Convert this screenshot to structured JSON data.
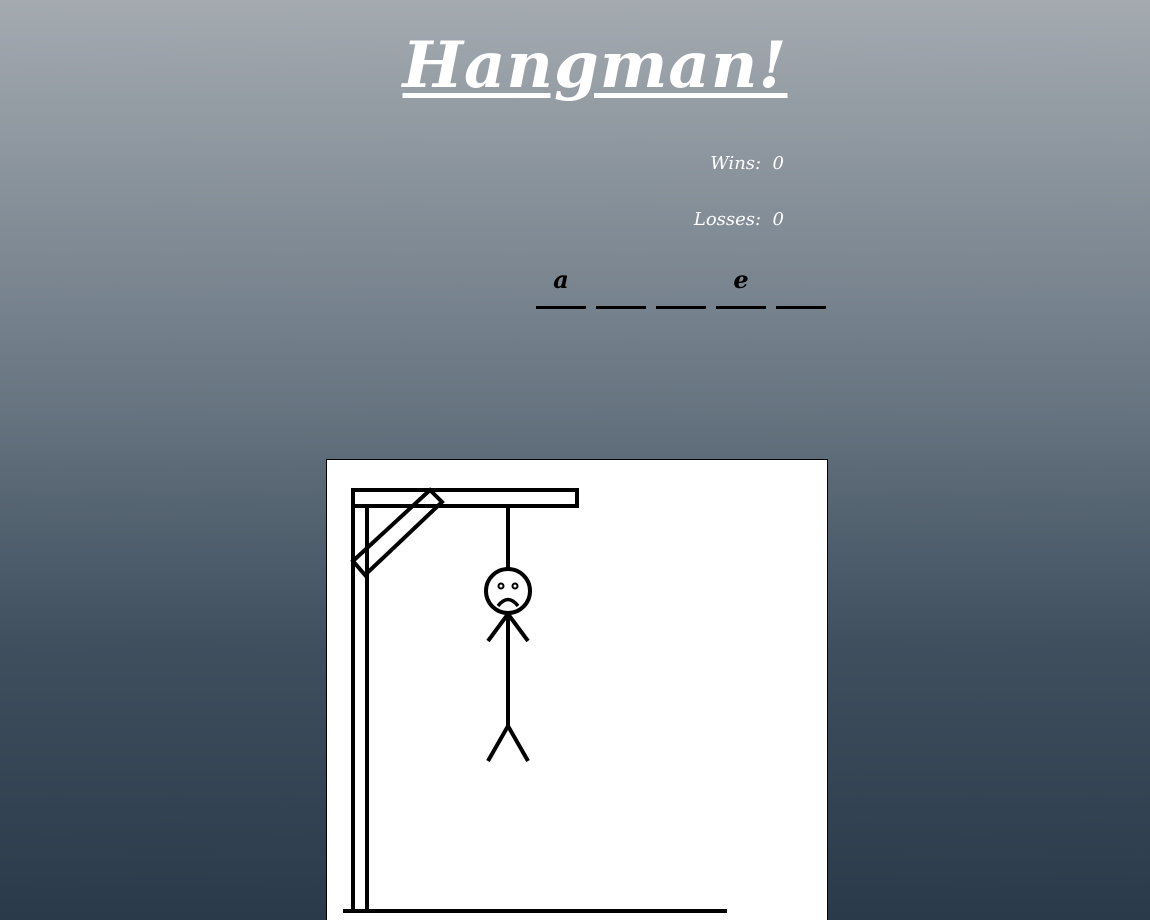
{
  "title": "Hangman!",
  "stats": {
    "wins_label": "Wins:",
    "wins_value": "0",
    "losses_label": "Losses:",
    "losses_value": "0"
  },
  "word_slots": [
    "a",
    "",
    "",
    "e",
    ""
  ],
  "game": {
    "wrong_guesses_parts_drawn": [
      "head",
      "body",
      "left-arm",
      "right-arm",
      "left-leg",
      "right-leg"
    ],
    "face": "sad"
  },
  "colors": {
    "background_top": "#a4aab0",
    "background_bottom": "#2a3a4a",
    "title": "#ffffff",
    "board": "#ffffff",
    "ink": "#000000"
  }
}
